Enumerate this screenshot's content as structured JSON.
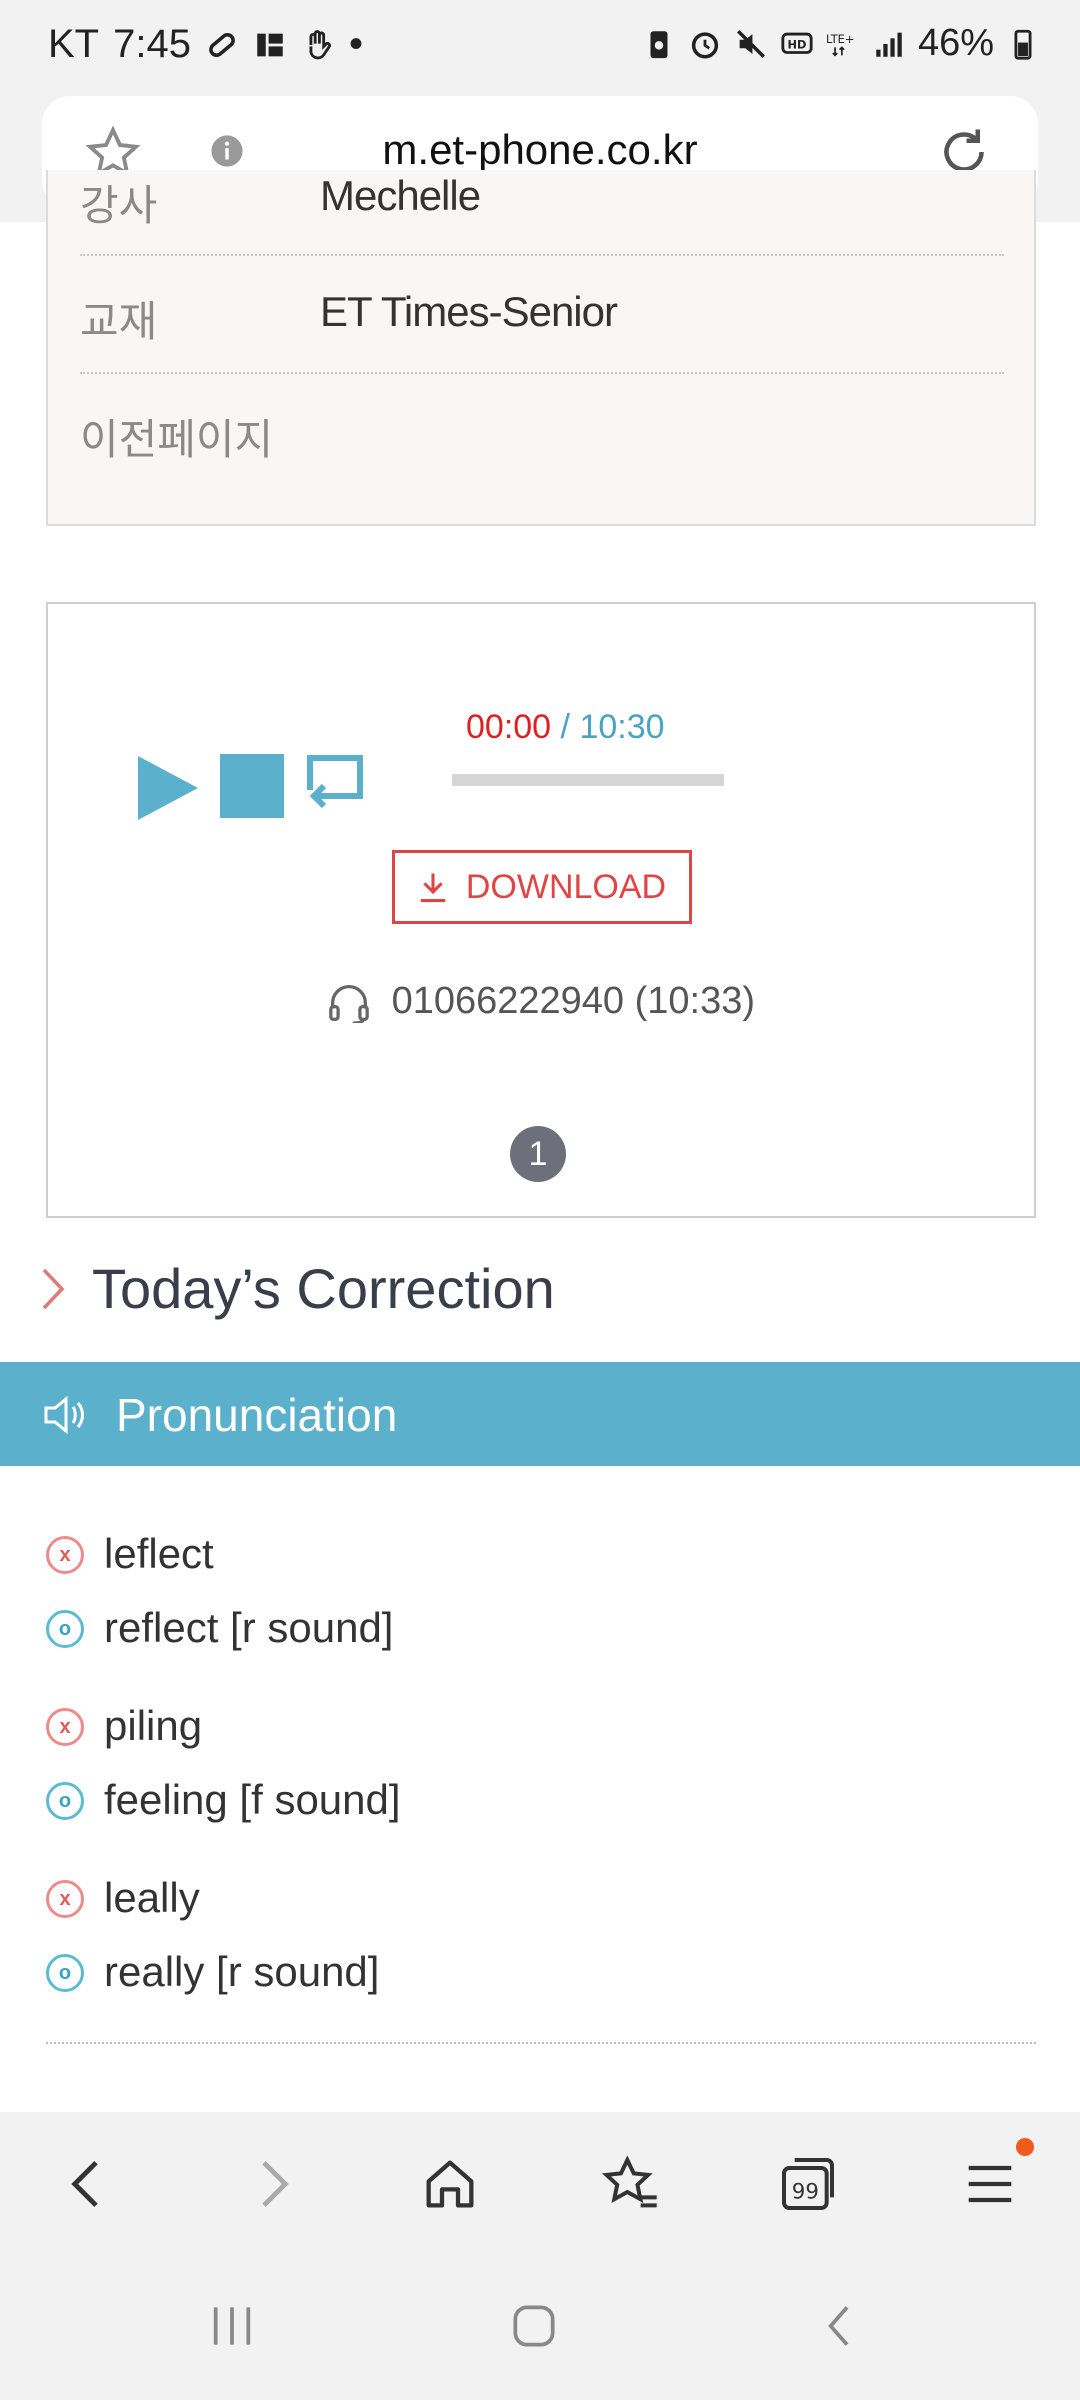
{
  "status_bar": {
    "carrier": "KT",
    "time": "7:45",
    "dot": "•",
    "battery": "46%"
  },
  "address_bar": {
    "url": "m.et-phone.co.kr"
  },
  "info": {
    "rows": [
      {
        "key": "강사",
        "value": "Mechelle"
      },
      {
        "key": "교재",
        "value": "ET Times-Senior"
      },
      {
        "key": "이전페이지",
        "value": ""
      }
    ]
  },
  "player": {
    "current_time": "00:00",
    "total_time": "/ 10:30",
    "progress_fraction": 0,
    "download_label": "DOWNLOAD",
    "phone_info": "01066222940 (10:33)",
    "page_number": "1"
  },
  "correction": {
    "title": "Today’s Correction",
    "section_label": "Pronunciation",
    "items": [
      {
        "wrong": "leflect",
        "right": "reflect [r sound]"
      },
      {
        "wrong": "piling",
        "right": "feeling [f sound]"
      },
      {
        "wrong": "leally",
        "right": "really [r sound]"
      }
    ],
    "wrong_mark": "x",
    "right_mark": "o"
  },
  "colors": {
    "accent_blue": "#5bb1cc",
    "error_red": "#e04545",
    "time_red": "#e02020"
  }
}
